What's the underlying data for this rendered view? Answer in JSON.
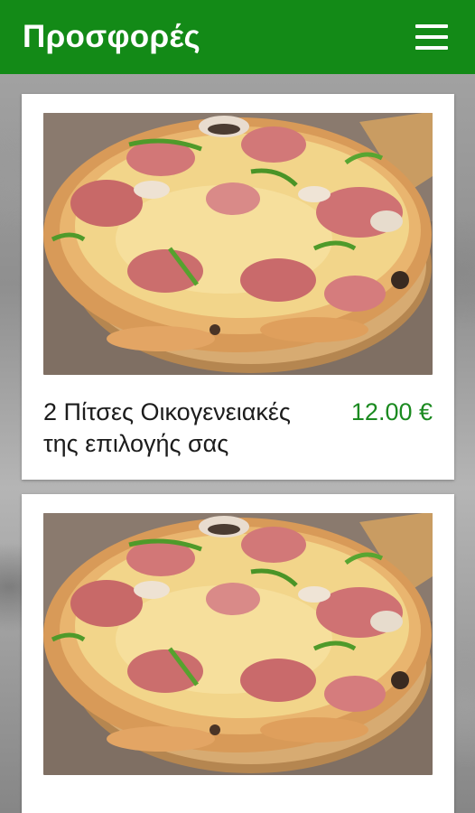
{
  "appbar": {
    "title": "Προσφορές",
    "menu_icon": "hamburger-menu-icon",
    "color": "#138a17"
  },
  "offers": [
    {
      "title": "2 Πίτσες Οικογενειακές της επιλογής σας",
      "price": "12.00 €",
      "image": "pizza-photo"
    },
    {
      "title": "",
      "price": "",
      "image": "pizza-photo"
    }
  ],
  "colors": {
    "price": "#1b8a20",
    "background": "grey-food-photo"
  }
}
